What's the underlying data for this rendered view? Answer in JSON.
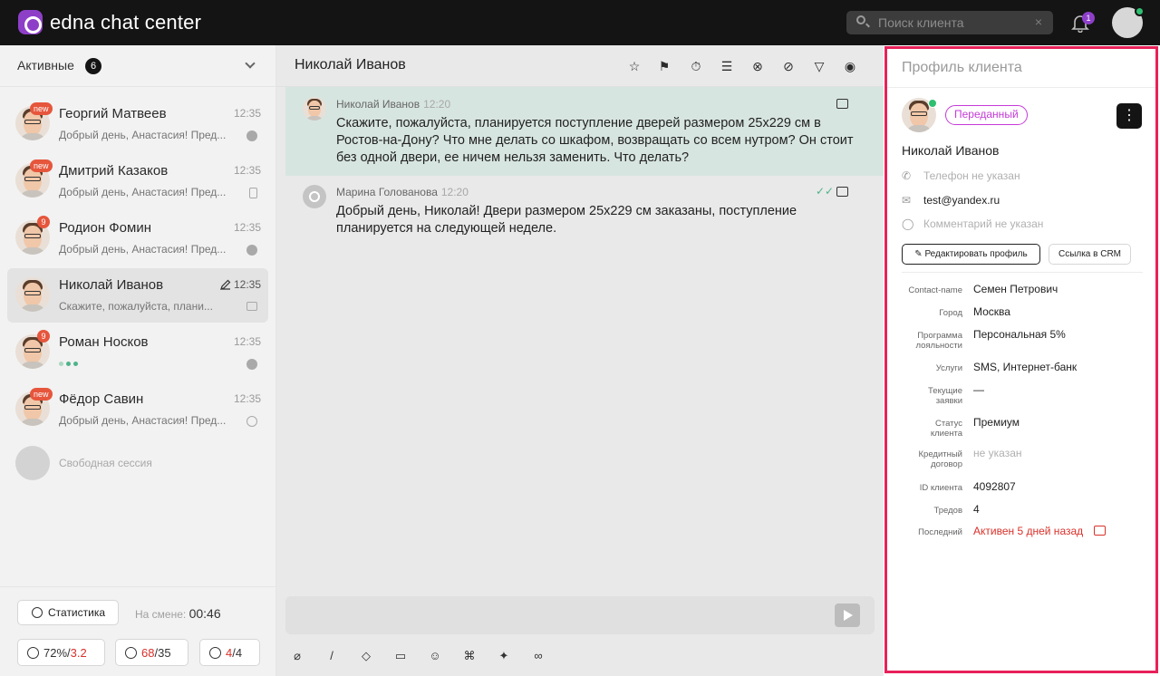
{
  "app": {
    "logo_text": "edna chat center"
  },
  "topbar": {
    "search_placeholder": "Поиск клиента",
    "clear": "×",
    "notifications_count": "1"
  },
  "left": {
    "header_title": "Активные",
    "active_count": "6",
    "chats": [
      {
        "name": "Георгий Матвеев",
        "time": "12:35",
        "preview": "Добрый день, Анастасия! Пред...",
        "badge": "new",
        "channel": "telegram"
      },
      {
        "name": "Дмитрий Казаков",
        "time": "12:35",
        "preview": "Добрый день, Анастасия! Пред...",
        "badge": "new",
        "channel": "mobile"
      },
      {
        "name": "Родион Фомин",
        "time": "12:35",
        "preview": "Добрый день, Анастасия! Пред...",
        "badge": "9",
        "channel": "telegram"
      },
      {
        "name": "Николай Иванов",
        "time": "12:35",
        "preview": "Скажите, пожалуйста, плани...",
        "badge": "",
        "channel": "web"
      },
      {
        "name": "Роман Носков",
        "time": "12:35",
        "preview": "",
        "badge": "9",
        "channel": "telegram"
      },
      {
        "name": "Фёдор Савин",
        "time": "12:35",
        "preview": "Добрый день, Анастасия! Пред...",
        "badge": "new",
        "channel": "whatsapp"
      }
    ],
    "free_session": "Свободная сессия",
    "stats_button": "Статистика",
    "shift_label": "На смене:",
    "shift_time": "00:46",
    "metrics": [
      {
        "main": "72%",
        "sep": " / ",
        "alt": "3.2"
      },
      {
        "main": "68",
        "sep": " / ",
        "alt": "35"
      },
      {
        "main": "4",
        "sep": " / ",
        "alt": "4"
      }
    ]
  },
  "center": {
    "title": "Николай Иванов",
    "messages": [
      {
        "author": "Николай Иванов",
        "time": "12:20",
        "text": "Скажите, пожалуйста, планируется поступление дверей размером 25х229 см в Ростов-на-Дону? Что мне делать со шкафом, возвращать со всем нутром? Он стоит без одной двери, ее ничем нельзя заменить. Что делать?"
      },
      {
        "author": "Марина Голованова",
        "time": "12:20",
        "text": "Добрый день, Николай! Двери размером 25х229 см заказаны, поступление планируется на следующей неделе."
      }
    ],
    "header_icons": [
      "star-icon",
      "signpost-icon",
      "timer-icon",
      "document-icon",
      "close-circle-icon",
      "block-icon",
      "filter-icon",
      "user-circle-icon"
    ],
    "toolbar_icons": [
      "paperclip-icon",
      "slash-icon",
      "tag-icon",
      "comment-icon",
      "smile-icon",
      "command-icon",
      "sparkle-icon",
      "link-icon"
    ]
  },
  "profile": {
    "title": "Профиль клиента",
    "status_tag": "Переданный",
    "name": "Николай Иванов",
    "phone": "Телефон не указан",
    "email": "test@yandex.ru",
    "comment": "Комментарий не указан",
    "edit_button": "Редактировать профиль",
    "crm_button": "Ссылка в CRM",
    "fields": [
      {
        "label": "Contact-name",
        "value": "Семен Петрович"
      },
      {
        "label": "Город",
        "value": "Москва"
      },
      {
        "label": "Программа лояльности",
        "value": "Персональная 5%"
      },
      {
        "label": "Услуги",
        "value": "SMS, Интернет-банк"
      },
      {
        "label": "Текущие заявки",
        "value": "—"
      },
      {
        "label": "Статус клиента",
        "value": "Премиум"
      },
      {
        "label": "Кредитный договор",
        "value": "не указан"
      },
      {
        "label": "ID клиента",
        "value": "4092807"
      },
      {
        "label": "Тредов",
        "value": "4"
      },
      {
        "label": "Последний",
        "value": "Активен 5 дней назад"
      }
    ]
  },
  "colors": {
    "accent": "#8e3fc8",
    "highlight_border": "#e8215a",
    "online": "#2fbf71",
    "alert": "#d9312a",
    "tag": "#c53ad8"
  }
}
